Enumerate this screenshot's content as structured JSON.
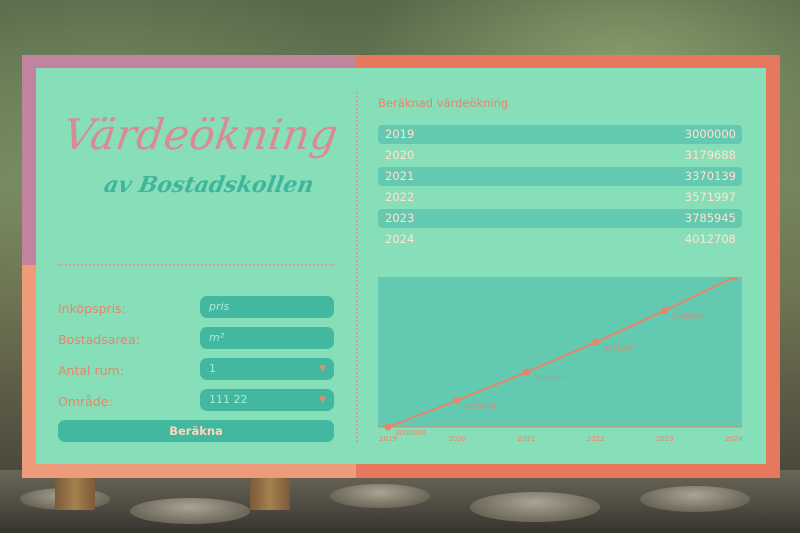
{
  "app": {
    "title": "Värdeökning",
    "subtitle": "av Bostadskollen"
  },
  "form": {
    "purchase_price": {
      "label": "Inköpspris:",
      "placeholder": "pris"
    },
    "area": {
      "label": "Bostadsarea:",
      "placeholder": "m²"
    },
    "rooms": {
      "label": "Antal rum:",
      "value": "1"
    },
    "region": {
      "label": "Område:",
      "value": "111 22"
    },
    "calculate_label": "Beräkna"
  },
  "results": {
    "title": "Beräknad värdeökning",
    "rows": [
      {
        "year": "2019",
        "value": "3000000"
      },
      {
        "year": "2020",
        "value": "3179688"
      },
      {
        "year": "2021",
        "value": "3370139"
      },
      {
        "year": "2022",
        "value": "3571997"
      },
      {
        "year": "2023",
        "value": "3785945"
      },
      {
        "year": "2024",
        "value": "4012708"
      }
    ]
  },
  "icons": {
    "dropdown": "chevron-down-icon"
  },
  "colors": {
    "accent": "#e8846a",
    "panel": "#87dfba",
    "control": "#43b8a0"
  },
  "chart_data": {
    "type": "line",
    "categories": [
      "2019",
      "2020",
      "2021",
      "2022",
      "2023",
      "2024"
    ],
    "series": [
      {
        "values": [
          3000000,
          3179688,
          3370139,
          3571997,
          3785945,
          4012708
        ]
      }
    ],
    "data_labels": [
      "3000000",
      "3179688",
      "3370139",
      "3571997",
      "3785945",
      "4012708"
    ],
    "ylim": [
      3000000,
      4012708
    ],
    "grid": false,
    "color": "#e8846a"
  }
}
